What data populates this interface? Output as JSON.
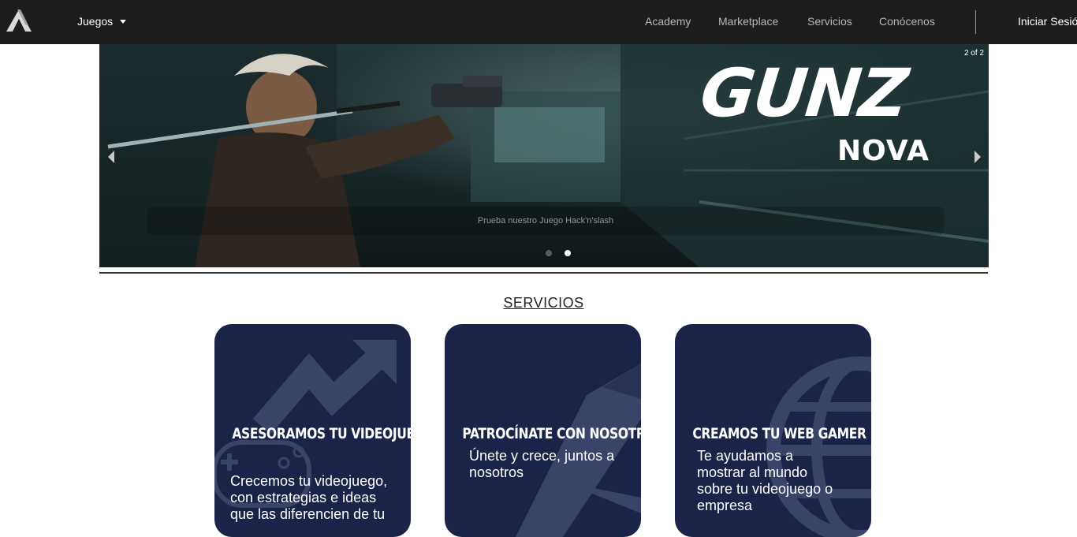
{
  "nav": {
    "logo_icon": "triangle-logo-icon",
    "games_label": "Juegos",
    "links": [
      "Academy",
      "Marketplace",
      "Servicios",
      "Conócenos"
    ],
    "login_label": "Iniciar Sesión"
  },
  "carousel": {
    "counter": "2 of 2",
    "title_main": "GUNZ",
    "title_sub": "NOVA",
    "caption": "Prueba nuestro Juego Hack'n'slash",
    "active_slide": 2,
    "slide_count": 2
  },
  "services": {
    "title": "SERVICIOS",
    "cards": [
      {
        "title": "ASESORAMOS TU VIDEOJUEGO",
        "desc": "Crecemos tu videojuego, con estrategias e ideas que las diferencien de tu",
        "icon": "growth-arrow-icon"
      },
      {
        "title": "PATROCÍNATE CON NOSOTROS",
        "desc": "Únete y crece, juntos a nosotros",
        "icon": "rocket-icon"
      },
      {
        "title": "CREAMOS TU WEB GAMER",
        "desc": "Te ayudamos a mostrar al mundo sobre tu videojuego o empresa",
        "icon": "globe-icon"
      }
    ]
  },
  "colors": {
    "nav_bg": "#1c1c1c",
    "card_bg": "#1b2448",
    "hero_bg": "#1a2a2c"
  }
}
